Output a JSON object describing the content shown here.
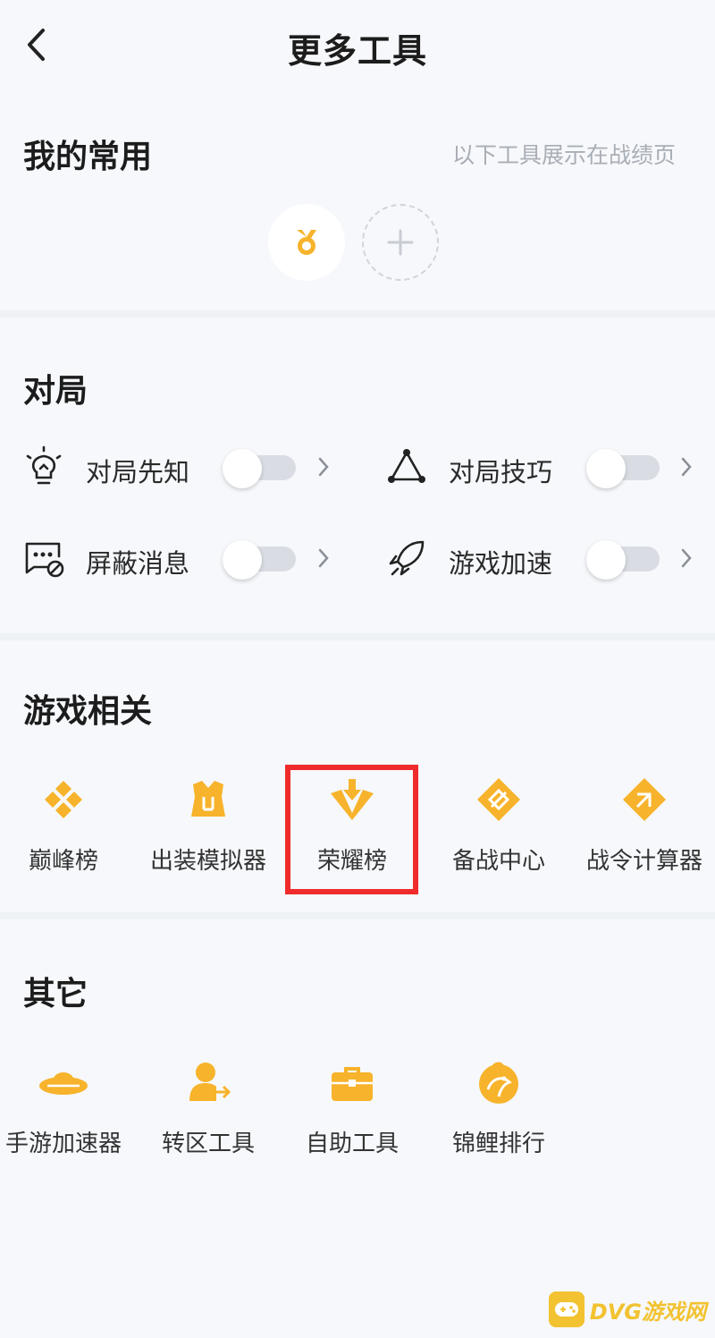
{
  "header": {
    "title": "更多工具"
  },
  "favorites": {
    "title": "我的常用",
    "hint": "以下工具展示在战绩页",
    "items": [
      {
        "icon": "medal-icon"
      }
    ],
    "add_icon": "plus-icon"
  },
  "match": {
    "title": "对局",
    "rows": [
      {
        "label": "对局先知",
        "icon": "lightbulb-icon",
        "enabled": false
      },
      {
        "label": "对局技巧",
        "icon": "triangle-nodes-icon",
        "enabled": false
      },
      {
        "label": "屏蔽消息",
        "icon": "chat-block-icon",
        "enabled": false
      },
      {
        "label": "游戏加速",
        "icon": "rocket-icon",
        "enabled": false
      }
    ]
  },
  "game": {
    "title": "游戏相关",
    "tools": [
      {
        "label": "巅峰榜",
        "icon": "peak-rank-icon"
      },
      {
        "label": "出装模拟器",
        "icon": "equipment-sim-icon"
      },
      {
        "label": "荣耀榜",
        "icon": "glory-rank-icon",
        "highlighted": true
      },
      {
        "label": "备战中心",
        "icon": "battle-prep-icon"
      },
      {
        "label": "战令计算器",
        "icon": "battle-pass-calc-icon"
      }
    ]
  },
  "other": {
    "title": "其它",
    "tools": [
      {
        "label": "手游加速器",
        "icon": "ufo-booster-icon"
      },
      {
        "label": "转区工具",
        "icon": "user-transfer-icon"
      },
      {
        "label": "自助工具",
        "icon": "toolbox-icon"
      },
      {
        "label": "锦鲤排行",
        "icon": "koi-fish-icon"
      }
    ]
  },
  "watermark": {
    "text": "DVG游戏网"
  },
  "colors": {
    "accent": "#f7b32b",
    "highlight_border": "#ef2b2b",
    "background": "#f6f8fb"
  }
}
